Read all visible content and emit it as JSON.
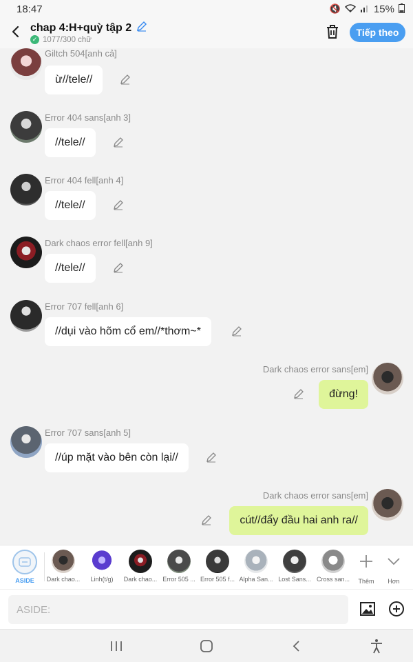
{
  "status": {
    "time": "18:47",
    "battery": "15%"
  },
  "header": {
    "title": "chap 4:H+quỳ tập 2",
    "word_count": "1077/300 chữ",
    "next_label": "Tiếp theo"
  },
  "messages": [
    {
      "side": "left",
      "name": "Giltch 504[anh cả]",
      "text": "ừ//tele//",
      "avatar_color": "#7a3e3e"
    },
    {
      "side": "left",
      "name": "Error 404 sans[anh 3]",
      "text": "//tele//",
      "avatar_color": "#3c3c3c"
    },
    {
      "side": "left",
      "name": "Error 404 fell[anh 4]",
      "text": "//tele//",
      "avatar_color": "#2e2e2e"
    },
    {
      "side": "left",
      "name": "Dark chaos error fell[anh 9]",
      "text": "//tele//",
      "avatar_color": "#8b1d24"
    },
    {
      "side": "left",
      "name": "Error 707 fell[anh 6]",
      "text": "//dụi vào hõm cổ em//*thơm~*",
      "avatar_color": "#2a2a2a"
    },
    {
      "side": "right",
      "name": "Dark chaos error sans[em]",
      "text": "đừng!",
      "avatar_color": "#5a4a44"
    },
    {
      "side": "left",
      "name": "Error 707 sans[anh 5]",
      "text": "//úp mặt vào bên còn lại//",
      "avatar_color": "#8fa5c4"
    },
    {
      "side": "right",
      "name": "Dark chaos error sans[em]",
      "text": "cút//đẩy đầu hai anh ra//",
      "avatar_color": "#5a4a44"
    }
  ],
  "characters": [
    {
      "label": "ASIDE",
      "color": "#f1f5f9"
    },
    {
      "label": "Dark chao...",
      "color": "#6b5a52"
    },
    {
      "label": "Linh(t/g)",
      "color": "#5a3ccf"
    },
    {
      "label": "Dark chao...",
      "color": "#2b2b2b"
    },
    {
      "label": "Error 505 ...",
      "color": "#4a4a4a"
    },
    {
      "label": "Error 505 f...",
      "color": "#3a3a3a"
    },
    {
      "label": "Alpha San...",
      "color": "#a9b2bb"
    },
    {
      "label": "Lost Sans...",
      "color": "#3f3f3f"
    },
    {
      "label": "Cross san...",
      "color": "#8a8a8a"
    }
  ],
  "char_actions": {
    "add_label": "Thêm",
    "more_label": "Hơn"
  },
  "input": {
    "placeholder": "ASIDE:"
  },
  "colors": {
    "accent": "#4a9ef1",
    "right_bubble": "#dff59a",
    "left_bubble": "#ffffff"
  }
}
